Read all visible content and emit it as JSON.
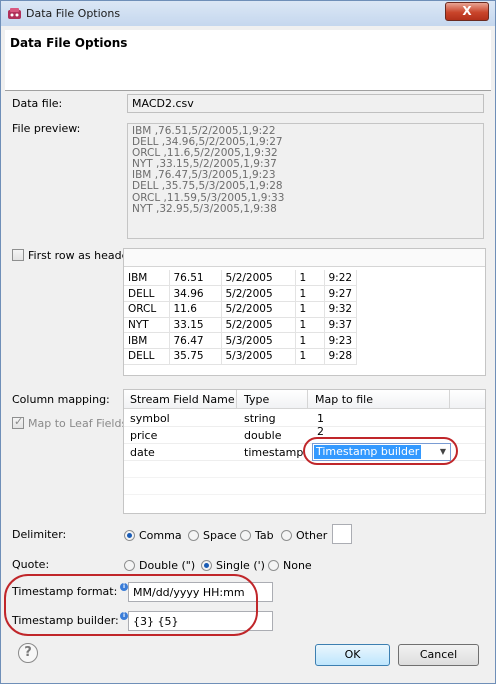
{
  "window": {
    "title": "Data File Options",
    "close_label": "X"
  },
  "header": {
    "title": "Data File Options"
  },
  "data_file": {
    "label": "Data file:",
    "value": "MACD2.csv"
  },
  "preview": {
    "label": "File preview:",
    "lines": [
      "IBM ,76.51,5/2/2005,1,9:22",
      "DELL ,34.96,5/2/2005,1,9:27",
      "ORCL ,11.6,5/2/2005,1,9:32",
      "NYT ,33.15,5/2/2005,1,9:37",
      "IBM ,76.47,5/3/2005,1,9:23",
      "DELL ,35.75,5/3/2005,1,9:28",
      "ORCL ,11.59,5/3/2005,1,9:33",
      "NYT ,32.95,5/3/2005,1,9:38"
    ]
  },
  "first_row_header": {
    "label": "First row as header",
    "checked": false
  },
  "parsed_rows": [
    [
      "IBM",
      "76.51",
      "5/2/2005",
      "1",
      "9:22"
    ],
    [
      "DELL",
      "34.96",
      "5/2/2005",
      "1",
      "9:27"
    ],
    [
      "ORCL",
      "11.6",
      "5/2/2005",
      "1",
      "9:32"
    ],
    [
      "NYT",
      "33.15",
      "5/2/2005",
      "1",
      "9:37"
    ],
    [
      "IBM",
      "76.47",
      "5/3/2005",
      "1",
      "9:23"
    ],
    [
      "DELL",
      "35.75",
      "5/3/2005",
      "1",
      "9:28"
    ]
  ],
  "column_mapping": {
    "label": "Column mapping:",
    "map_leaf": {
      "label": "Map to Leaf Fields",
      "checked": true
    },
    "headers": [
      "Stream Field Name",
      "Type",
      "Map to file"
    ],
    "rows": [
      [
        "symbol",
        "string",
        "1"
      ],
      [
        "price",
        "double",
        "2"
      ],
      [
        "date",
        "timestamp",
        "Timestamp builder"
      ]
    ]
  },
  "delimiter": {
    "label": "Delimiter:",
    "options": [
      "Comma",
      "Space",
      "Tab",
      "Other"
    ],
    "selected": "Comma"
  },
  "quote": {
    "label": "Quote:",
    "options": [
      "Double (\")",
      "Single (')",
      "None"
    ],
    "selected": "Single (')"
  },
  "timestamp_format": {
    "label": "Timestamp format:",
    "value": "MM/dd/yyyy HH:mm"
  },
  "timestamp_builder": {
    "label": "Timestamp builder:",
    "value": "{3} {5}"
  },
  "buttons": {
    "ok": "OK",
    "cancel": "Cancel"
  },
  "icons": {
    "help": "help-icon",
    "info": "info-icon",
    "dropdown": "chevron-down-icon"
  },
  "colors": {
    "highlight": "#3399ff",
    "annotation": "#c0262a"
  }
}
